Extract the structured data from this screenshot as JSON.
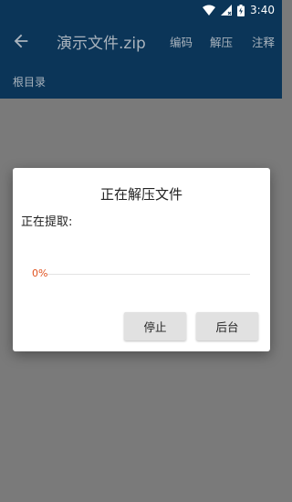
{
  "status_bar": {
    "time": "3:40",
    "icons": [
      "wifi-icon",
      "signal-icon",
      "battery-charging-icon"
    ]
  },
  "app_bar": {
    "title": "演示文件.zip",
    "actions": {
      "encoding": "编码",
      "extract": "解压",
      "comment": "注释"
    }
  },
  "breadcrumb": {
    "label": "根目录"
  },
  "dialog": {
    "title": "正在解压文件",
    "extracting_label": "正在提取:",
    "progress": {
      "percent_text": "0%",
      "value": 0,
      "color": "#e0521f"
    },
    "buttons": {
      "stop": "停止",
      "background": "后台"
    }
  },
  "colors": {
    "toolbar": "#0b3558",
    "overlay": "#7a7a7a",
    "accent": "#e0521f"
  }
}
